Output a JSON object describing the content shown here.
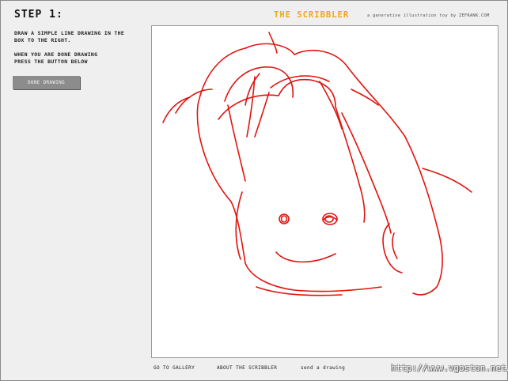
{
  "left_panel": {
    "step_title": "STEP 1:",
    "instructions_line1": "DRAW A SIMPLE LINE DRAWING IN THE",
    "instructions_line2": "BOX TO THE RIGHT.",
    "instructions_line3": "WHEN YOU ARE DONE DRAWING",
    "instructions_line4": "PRESS THE BUTTON BELOW",
    "done_button_label": "DONE DRAWING"
  },
  "header": {
    "brand": "THE SCRIBBLER",
    "tagline": "a generative illustration toy by ZEFRANK.COM"
  },
  "footer": {
    "gallery_link": "GO TO GALLERY",
    "about_link": "ABOUT THE SCRIBBLER",
    "send_link": "send a drawing"
  },
  "watermark": "http://www.vgoston.net/",
  "colors": {
    "brand": "#f3a41a",
    "stroke": "#e0140f",
    "button": "#8c8c8c",
    "panel_bg": "#efefef"
  }
}
